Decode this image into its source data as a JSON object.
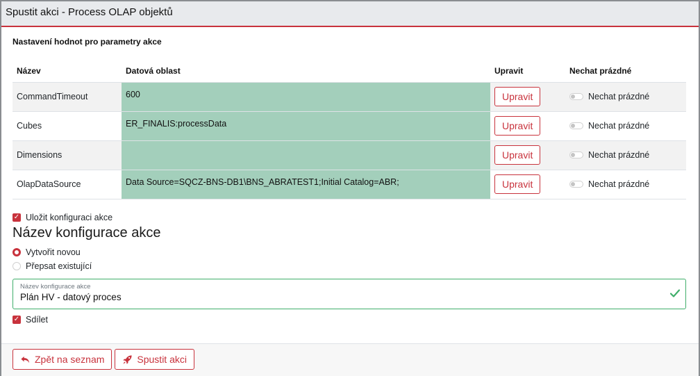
{
  "window": {
    "title": "Spustit akci - Process OLAP objektů"
  },
  "section": {
    "heading": "Nastavení hodnot pro parametry akce"
  },
  "table": {
    "headers": [
      "Název",
      "Datová oblast",
      "Upravit",
      "Nechat prázdné"
    ],
    "rows": [
      {
        "name": "CommandTimeout",
        "value": "600",
        "edit_label": "Upravit",
        "empty_label": "Nechat prázdné"
      },
      {
        "name": "Cubes",
        "value": "ER_FINALIS:processData",
        "edit_label": "Upravit",
        "empty_label": "Nechat prázdné"
      },
      {
        "name": "Dimensions",
        "value": "",
        "edit_label": "Upravit",
        "empty_label": "Nechat prázdné"
      },
      {
        "name": "OlapDataSource",
        "value": "Data Source=SQCZ-BNS-DB1\\BNS_ABRATEST1;Initial Catalog=ABR;",
        "edit_label": "Upravit",
        "empty_label": "Nechat prázdné"
      }
    ]
  },
  "save_config": {
    "label": "Uložit konfiguraci akce",
    "checked": true
  },
  "config": {
    "title": "Název konfigurace akce",
    "radio_new": "Vytvořit novou",
    "radio_overwrite": "Přepsat existující",
    "selected": "Vytvořit novou",
    "field_label": "Název konfigurace akce",
    "field_value": "Plán HV - datový proces"
  },
  "share": {
    "label": "Sdílet",
    "checked": true
  },
  "footer": {
    "back_label": "Zpět na seznam",
    "run_label": "Spustit akci"
  },
  "colors": {
    "accent": "#c8323c",
    "value_bg": "#a3cfbb",
    "valid": "#3fae6a"
  },
  "icons": {
    "check": "checkmark-icon",
    "back": "undo-arrow-icon",
    "run": "rocket-icon"
  }
}
